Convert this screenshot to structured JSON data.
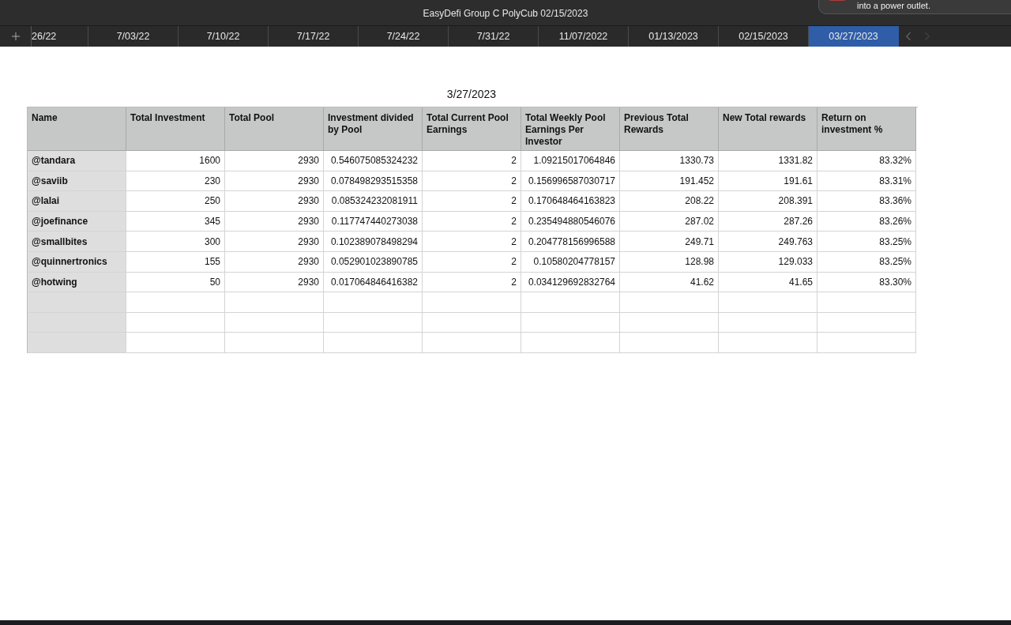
{
  "window": {
    "title": "EasyDefi Group C PolyCub 02/15/2023"
  },
  "notification": {
    "text": "into a power outlet."
  },
  "tabs": [
    {
      "label": "26/22",
      "selected": false
    },
    {
      "label": "7/03/22",
      "selected": false
    },
    {
      "label": "7/10/22",
      "selected": false
    },
    {
      "label": "7/17/22",
      "selected": false
    },
    {
      "label": "7/24/22",
      "selected": false
    },
    {
      "label": "7/31/22",
      "selected": false
    },
    {
      "label": "11/07/2022",
      "selected": false
    },
    {
      "label": "01/13/2023",
      "selected": false
    },
    {
      "label": "02/15/2023",
      "selected": false
    },
    {
      "label": "03/27/2023",
      "selected": true
    }
  ],
  "sheet": {
    "title": "3/27/2023",
    "table": {
      "columns": [
        "Name",
        "Total Investment",
        "Total Pool",
        "Investment divided by Pool",
        "Total Current Pool Earnings",
        "Total Weekly Pool Earnings Per Investor",
        "Previous Total Rewards",
        "New Total rewards",
        "Return on investment %"
      ],
      "rows": [
        {
          "kind": "data",
          "cells": [
            "@tandara",
            "1600",
            "2930",
            "0.546075085324232",
            "2",
            "1.09215017064846",
            "1330.73",
            "1331.82",
            "83.32%"
          ]
        },
        {
          "kind": "data",
          "cells": [
            "@saviib",
            "230",
            "2930",
            "0.078498293515358",
            "2",
            "0.156996587030717",
            "191.452",
            "191.61",
            "83.31%"
          ]
        },
        {
          "kind": "data",
          "cells": [
            "@lalai",
            "250",
            "2930",
            "0.085324232081911",
            "2",
            "0.170648464163823",
            "208.22",
            "208.391",
            "83.36%"
          ]
        },
        {
          "kind": "data",
          "cells": [
            "@joefinance",
            "345",
            "2930",
            "0.117747440273038",
            "2",
            "0.235494880546076",
            "287.02",
            "287.26",
            "83.26%"
          ]
        },
        {
          "kind": "data",
          "cells": [
            "@smallbites",
            "300",
            "2930",
            "0.102389078498294",
            "2",
            "0.204778156996588",
            "249.71",
            "249.763",
            "83.25%"
          ]
        },
        {
          "kind": "data",
          "cells": [
            "@quinnertronics",
            "155",
            "2930",
            "0.052901023890785",
            "2",
            "0.10580204778157",
            "128.98",
            "129.033",
            "83.25%"
          ]
        },
        {
          "kind": "data",
          "cells": [
            "@hotwing",
            "50",
            "2930",
            "0.017064846416382",
            "2",
            "0.034129692832764",
            "41.62",
            "41.65",
            "83.30%"
          ]
        },
        {
          "kind": "empty"
        },
        {
          "kind": "empty"
        },
        {
          "kind": "empty"
        }
      ]
    }
  }
}
